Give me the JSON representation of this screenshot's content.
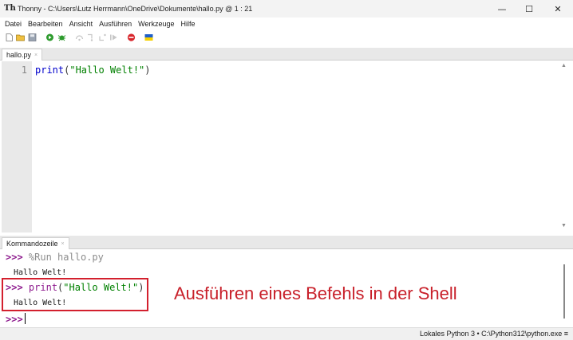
{
  "window": {
    "app_icon": "Th",
    "title": "Thonny  -  C:\\Users\\Lutz Herrmann\\OneDrive\\Dokumente\\hallo.py  @  1 : 21",
    "minimize": "—",
    "maximize": "☐",
    "close": "✕"
  },
  "menu": {
    "items": [
      "Datei",
      "Bearbeiten",
      "Ansicht",
      "Ausführen",
      "Werkzeuge",
      "Hilfe"
    ]
  },
  "toolbar": {
    "icons": [
      "new-file-icon",
      "open-folder-icon",
      "save-icon",
      "run-icon",
      "debug-icon",
      "step-over-icon",
      "step-into-icon",
      "step-out-icon",
      "resume-icon",
      "stop-icon",
      "ukraine-flag-icon"
    ],
    "colors": {
      "run": "#2e9b2e",
      "stop": "#d8262c",
      "flag_blue": "#1f5fc8",
      "flag_yellow": "#f5d000"
    }
  },
  "editor": {
    "tab_label": "hallo.py",
    "tab_close": "×",
    "line_number": "1",
    "code_fn": "print",
    "code_open": "(",
    "code_string": "\"Hallo Welt!\"",
    "code_close": ")"
  },
  "shell": {
    "tab_label": "Kommandozeile",
    "tab_close": "×",
    "prompt": ">>>",
    "run_command": "%Run hallo.py",
    "output_1": "Hallo Welt!",
    "command_fn": "print",
    "command_open": "(",
    "command_string": "\"Hallo Welt!\"",
    "command_close": ")",
    "output_2": "Hallo Welt!"
  },
  "annotation": {
    "text": "Ausführen eines Befehls in der Shell",
    "color": "#c8202a"
  },
  "status": {
    "text": "Lokales Python 3  •  C:\\Python312\\python.exe  ≡"
  }
}
